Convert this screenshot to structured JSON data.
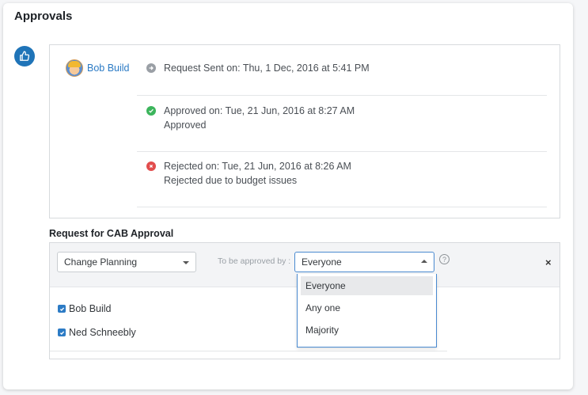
{
  "card": {
    "title": "Approvals"
  },
  "history": {
    "requester": "Bob Build",
    "events": [
      {
        "type": "sent",
        "line1": "Request Sent on: Thu, 1 Dec, 2016 at 5:41 PM",
        "line2": ""
      },
      {
        "type": "approved",
        "line1": "Approved on: Tue, 21 Jun, 2016 at 8:27 AM",
        "line2": "Approved"
      },
      {
        "type": "rejected",
        "line1": "Rejected on: Tue, 21 Jun, 2016 at 8:26 AM",
        "line2": "Rejected due to budget issues"
      }
    ]
  },
  "cab": {
    "title": "Request for CAB Approval",
    "group_select": {
      "value": "Change Planning"
    },
    "to_be_approved_label": "To be approved by :",
    "rule_select": {
      "value": "Everyone",
      "options": [
        "Everyone",
        "Any one",
        "Majority"
      ],
      "selected_index": 0
    },
    "help_glyph": "?",
    "close_glyph": "×",
    "approvers": [
      {
        "name": "Bob Build",
        "checked": true
      },
      {
        "name": "Ned Schneebly",
        "checked": true
      }
    ]
  },
  "icons": {
    "thumb": "thumbs-up-icon",
    "sent": "arrow-right-circle-icon",
    "approved": "check-circle-icon",
    "rejected": "x-circle-icon"
  },
  "colors": {
    "accent": "#1f74b8",
    "link": "#2c7bc5",
    "approved": "#3cb55c",
    "rejected": "#e24d4d",
    "sent": "#9a9fa5"
  }
}
